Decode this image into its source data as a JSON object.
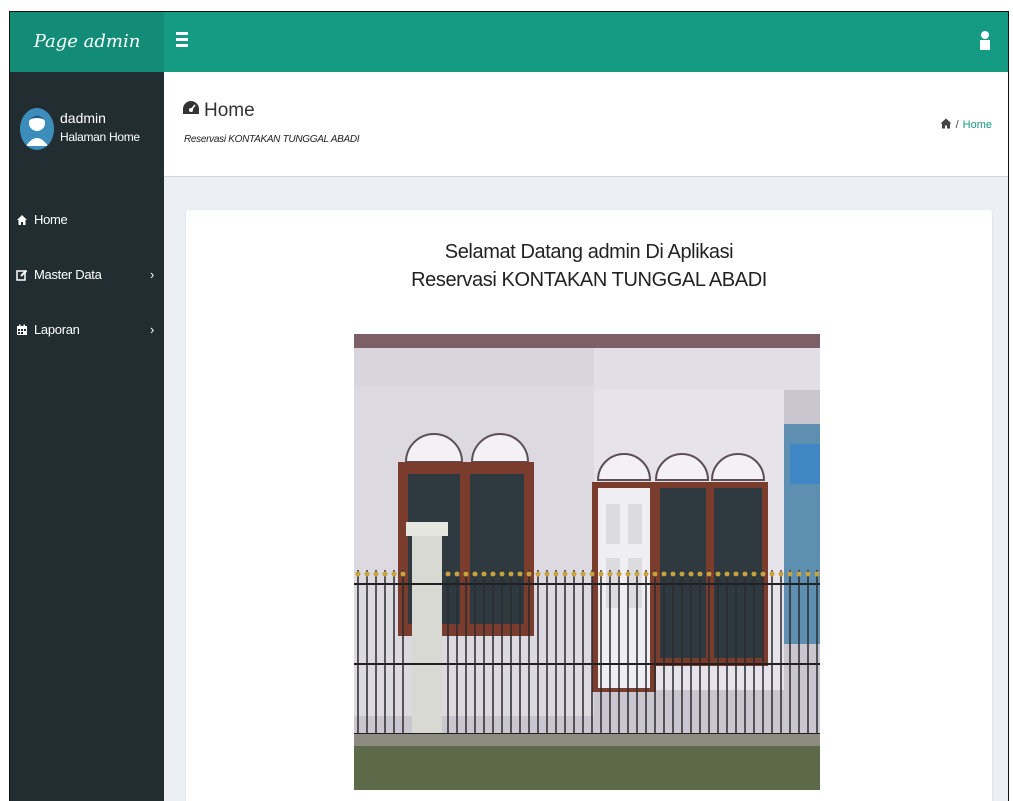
{
  "app": {
    "logo": "Page admin"
  },
  "topbar": {
    "menu_toggle_icon": "hamburger-icon",
    "user_icon": "user-icon"
  },
  "sidebar": {
    "user": {
      "name": "dadmin",
      "subtitle": "Halaman Home",
      "avatar_icon": "avatar-icon"
    },
    "items": [
      {
        "label": "Home",
        "icon": "home-icon",
        "has_submenu": false
      },
      {
        "label": "Master Data",
        "icon": "edit-icon",
        "has_submenu": true
      },
      {
        "label": "Laporan",
        "icon": "calendar-icon",
        "has_submenu": true
      }
    ]
  },
  "header": {
    "title": "Home",
    "title_icon": "dashboard-icon",
    "subtitle": "Reservasi KONTAKAN TUNGGAL ABADI",
    "breadcrumb": {
      "home_icon": "home-icon",
      "separator": "/",
      "current": "Home"
    }
  },
  "main": {
    "welcome_line1": "Selamat Datang admin Di Aplikasi",
    "welcome_line2": "Reservasi KONTAKAN TUNGGAL ABADI",
    "photo": "house-photo"
  },
  "colors": {
    "topbar": "#159a83",
    "logo_bg": "#128c77",
    "sidebar": "#222d32",
    "content_bg": "#ecf0f5"
  }
}
